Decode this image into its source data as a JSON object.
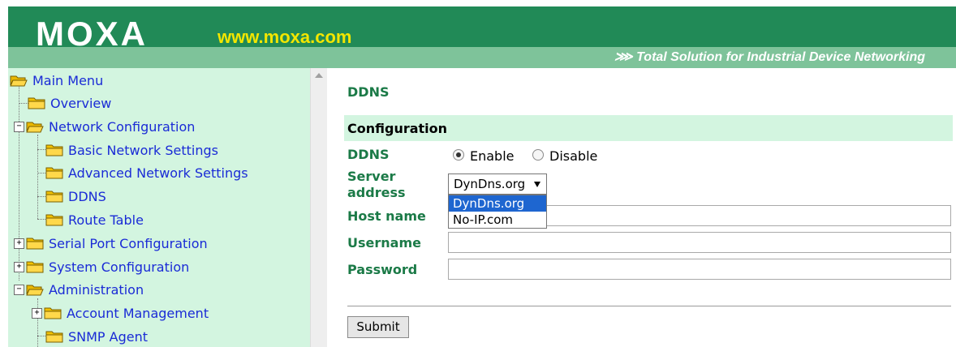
{
  "header": {
    "logo": "MOXA",
    "site": "www.moxa.com",
    "tagline": "⋙ Total Solution for Industrial Device Networking"
  },
  "sidebar": {
    "items": [
      {
        "label": "Main Menu",
        "icon": "open-folder-icon",
        "expander": ""
      },
      {
        "label": "Overview",
        "icon": "folder-icon",
        "expander": ""
      },
      {
        "label": "Network Configuration",
        "icon": "open-folder-icon",
        "expander": "−"
      },
      {
        "label": "Basic Network Settings",
        "icon": "folder-icon",
        "expander": ""
      },
      {
        "label": "Advanced Network Settings",
        "icon": "folder-icon",
        "expander": ""
      },
      {
        "label": "DDNS",
        "icon": "folder-icon",
        "expander": ""
      },
      {
        "label": "Route Table",
        "icon": "folder-icon",
        "expander": ""
      },
      {
        "label": "Serial Port Configuration",
        "icon": "folder-icon",
        "expander": "+"
      },
      {
        "label": "System Configuration",
        "icon": "folder-icon",
        "expander": "+"
      },
      {
        "label": "Administration",
        "icon": "open-folder-icon",
        "expander": "−"
      },
      {
        "label": "Account Management",
        "icon": "folder-icon",
        "expander": "+"
      },
      {
        "label": "SNMP Agent",
        "icon": "folder-icon",
        "expander": ""
      }
    ]
  },
  "main": {
    "title": "DDNS",
    "section": "Configuration",
    "ddns_label": "DDNS",
    "enable_label": "Enable",
    "disable_label": "Disable",
    "ddns_value": "Enable",
    "server_label_1": "Server",
    "server_label_2": "address",
    "server_value": "DynDns.org",
    "server_options": [
      "DynDns.org",
      "No-IP.com"
    ],
    "host_label": "Host name",
    "username_label": "Username",
    "password_label": "Password",
    "host_value": "",
    "username_value": "",
    "password_value": "",
    "submit_label": "Submit"
  },
  "colors": {
    "header_green": "#218a57",
    "accent_green": "#1b7a47",
    "menu_bg": "#d3f5e0",
    "link_blue": "#1a2bd6",
    "site_yellow": "#f2e600"
  }
}
